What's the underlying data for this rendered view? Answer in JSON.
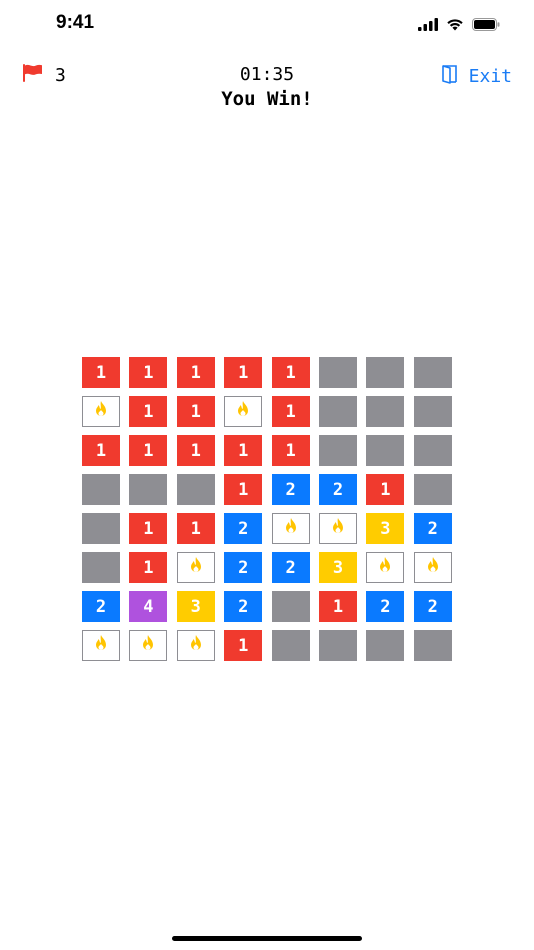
{
  "status_bar": {
    "time": "9:41"
  },
  "header": {
    "flag_count": "3",
    "timer": "01:35",
    "exit_label": "Exit",
    "result": "You Win!"
  },
  "colors": {
    "hidden": "#8e8e93",
    "one": "#f03a2e",
    "two": "#0a7aff",
    "three": "#ffcc00",
    "four": "#af52de",
    "accent": "#1a7cf5",
    "flag": "#f03a2e"
  },
  "board": {
    "rows": 8,
    "cols": 8,
    "cells": [
      [
        "1",
        "1",
        "1",
        "1",
        "1",
        "H",
        "H",
        "H"
      ],
      [
        "M",
        "1",
        "1",
        "M",
        "1",
        "H",
        "H",
        "H"
      ],
      [
        "1",
        "1",
        "1",
        "1",
        "1",
        "H",
        "H",
        "H"
      ],
      [
        "H",
        "H",
        "H",
        "1",
        "2",
        "2",
        "1",
        "H"
      ],
      [
        "H",
        "1",
        "1",
        "2",
        "M",
        "M",
        "3",
        "2"
      ],
      [
        "H",
        "1",
        "M",
        "2",
        "2",
        "3",
        "M",
        "M"
      ],
      [
        "2",
        "4",
        "3",
        "2",
        "H",
        "1",
        "2",
        "2"
      ],
      [
        "M",
        "M",
        "M",
        "1",
        "H",
        "H",
        "H",
        "H"
      ]
    ]
  }
}
